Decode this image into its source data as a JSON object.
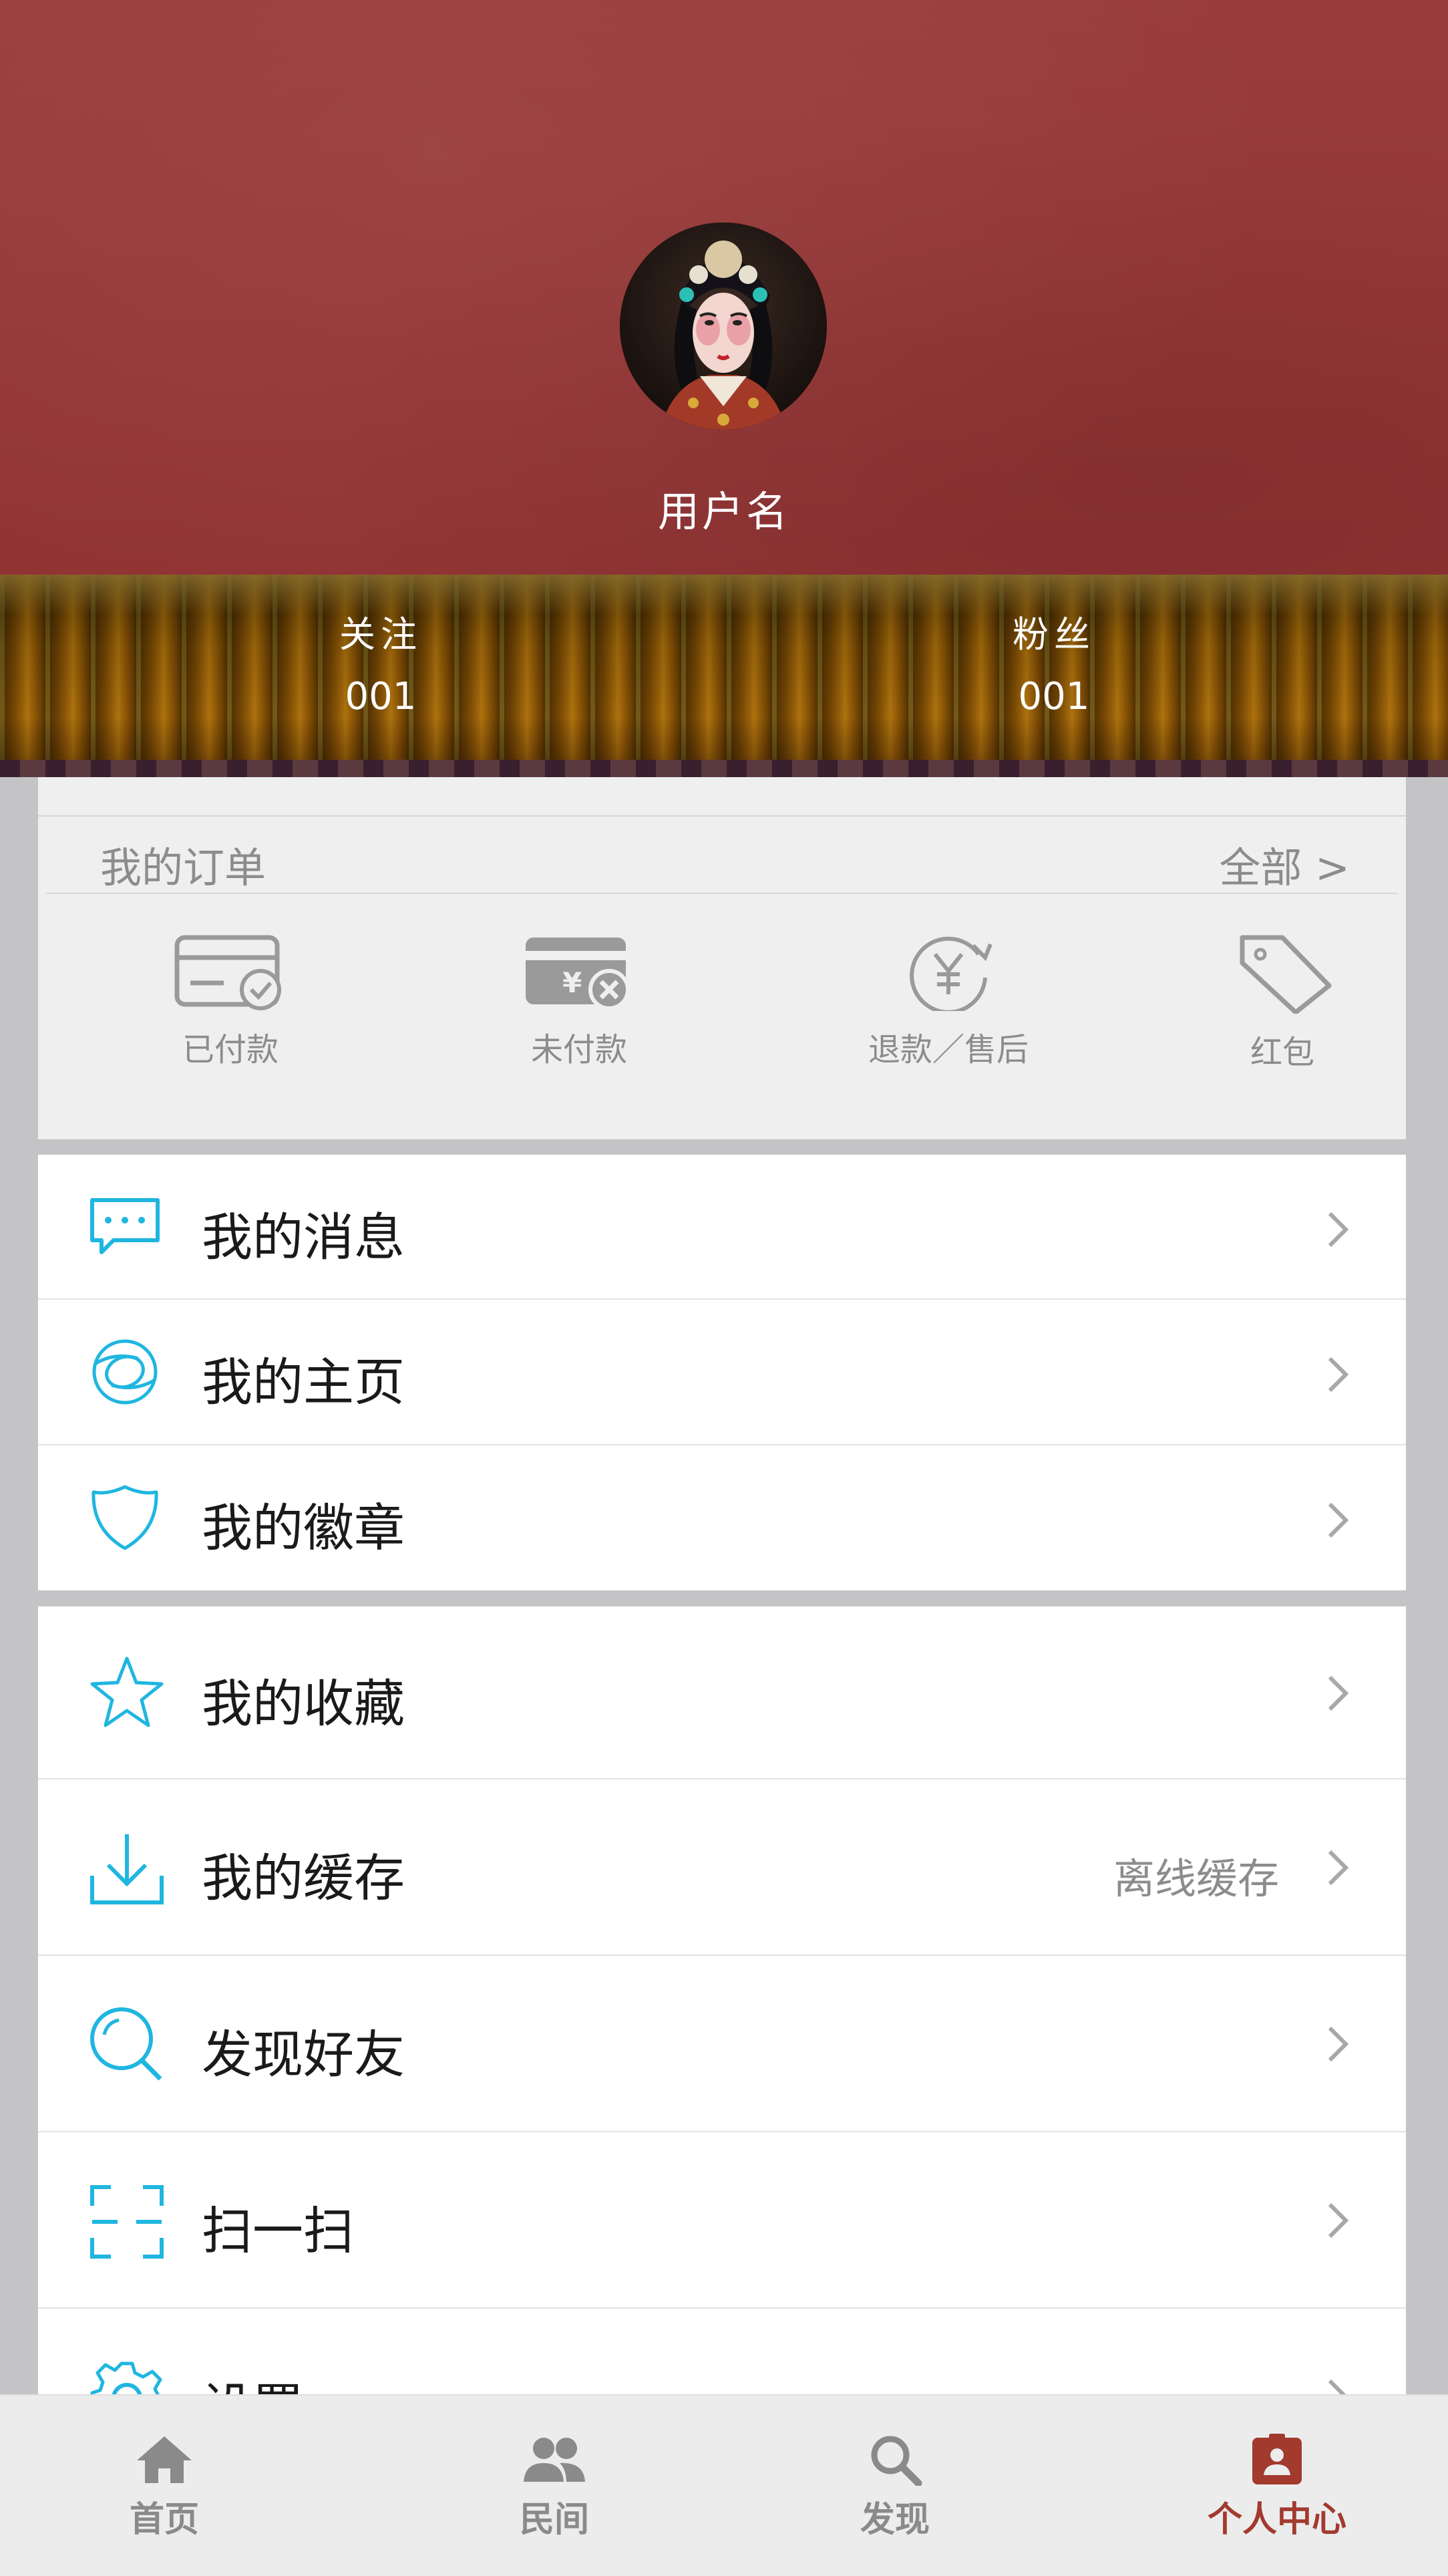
{
  "profile": {
    "username": "用户名",
    "stats": [
      {
        "label": "关注",
        "value": "001"
      },
      {
        "label": "粉丝",
        "value": "001"
      }
    ]
  },
  "orders": {
    "title": "我的订单",
    "all_link": "全部 >",
    "items": [
      {
        "label": "已付款",
        "icon": "card-check-icon"
      },
      {
        "label": "未付款",
        "icon": "card-x-icon"
      },
      {
        "label": "退款／售后",
        "icon": "yuan-refresh-icon"
      },
      {
        "label": "红包",
        "icon": "tag-icon"
      }
    ]
  },
  "menu_group1": [
    {
      "label": "我的消息",
      "icon": "message-icon"
    },
    {
      "label": "我的主页",
      "icon": "home-ring-icon"
    },
    {
      "label": "我的徽章",
      "icon": "badge-shield-icon"
    }
  ],
  "menu_group2": [
    {
      "label": "我的收藏",
      "icon": "star-icon",
      "sub": ""
    },
    {
      "label": "我的缓存",
      "icon": "download-icon",
      "sub": "离线缓存"
    },
    {
      "label": "发现好友",
      "icon": "search-icon",
      "sub": ""
    },
    {
      "label": "扫一扫",
      "icon": "scan-icon",
      "sub": ""
    },
    {
      "label": "设置",
      "icon": "gear-icon",
      "sub": ""
    }
  ],
  "tabs": [
    {
      "label": "首页",
      "icon": "house-icon"
    },
    {
      "label": "民间",
      "icon": "people-icon"
    },
    {
      "label": "发现",
      "icon": "search-icon"
    },
    {
      "label": "个人中心",
      "icon": "profile-clipboard-icon",
      "active": true
    }
  ],
  "colors": {
    "accent_icon": "#1fb6e0",
    "header_red": "#943535",
    "active_tab": "#a23a2e",
    "inactive_gray": "#8a8a8a"
  }
}
